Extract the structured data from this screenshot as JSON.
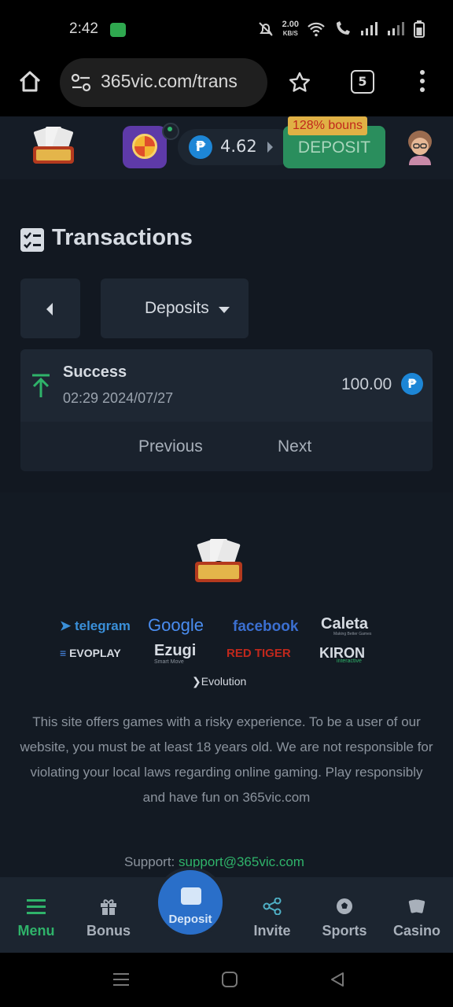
{
  "status_bar": {
    "time": "2:42",
    "speed_value": "2.00",
    "speed_unit": "KB/S"
  },
  "browser": {
    "url": "365vic.com/trans",
    "tab_count": "5"
  },
  "header": {
    "balance": "4.62",
    "currency_symbol": "₱",
    "bonus_tag": "128% bouns",
    "deposit_label": "DEPOSIT"
  },
  "page": {
    "title": "Transactions",
    "filter_selected": "Deposits"
  },
  "transactions": [
    {
      "status": "Success",
      "datetime": "02:29 2024/07/27",
      "amount": "100.00",
      "direction": "up",
      "color": "#2fb36a"
    }
  ],
  "pager": {
    "previous_label": "Previous",
    "next_label": "Next"
  },
  "footer": {
    "partners": [
      "telegram",
      "Google",
      "facebook",
      "Caleta",
      "EVOPLAY",
      "Ezugi",
      "RED TIGER",
      "KIRON",
      "Evolution"
    ],
    "ezugi_sub": "Smart Move",
    "caleta_sub": "Making Better Games",
    "kiron_sub": "interactive",
    "disclaimer": "This site offers games with a risky experience. To be a user of our website, you must be at least 18 years old. We are not responsible for violating your local laws regarding online gaming. Play responsibly and have fun on 365vic.com",
    "support_prefix": "Support: ",
    "support_email": "support@365vic.com"
  },
  "bottom_nav": {
    "menu": "Menu",
    "bonus": "Bonus",
    "deposit": "Deposit",
    "invite": "Invite",
    "sports": "Sports",
    "casino": "Casino",
    "active_color": "#2fb36a"
  }
}
